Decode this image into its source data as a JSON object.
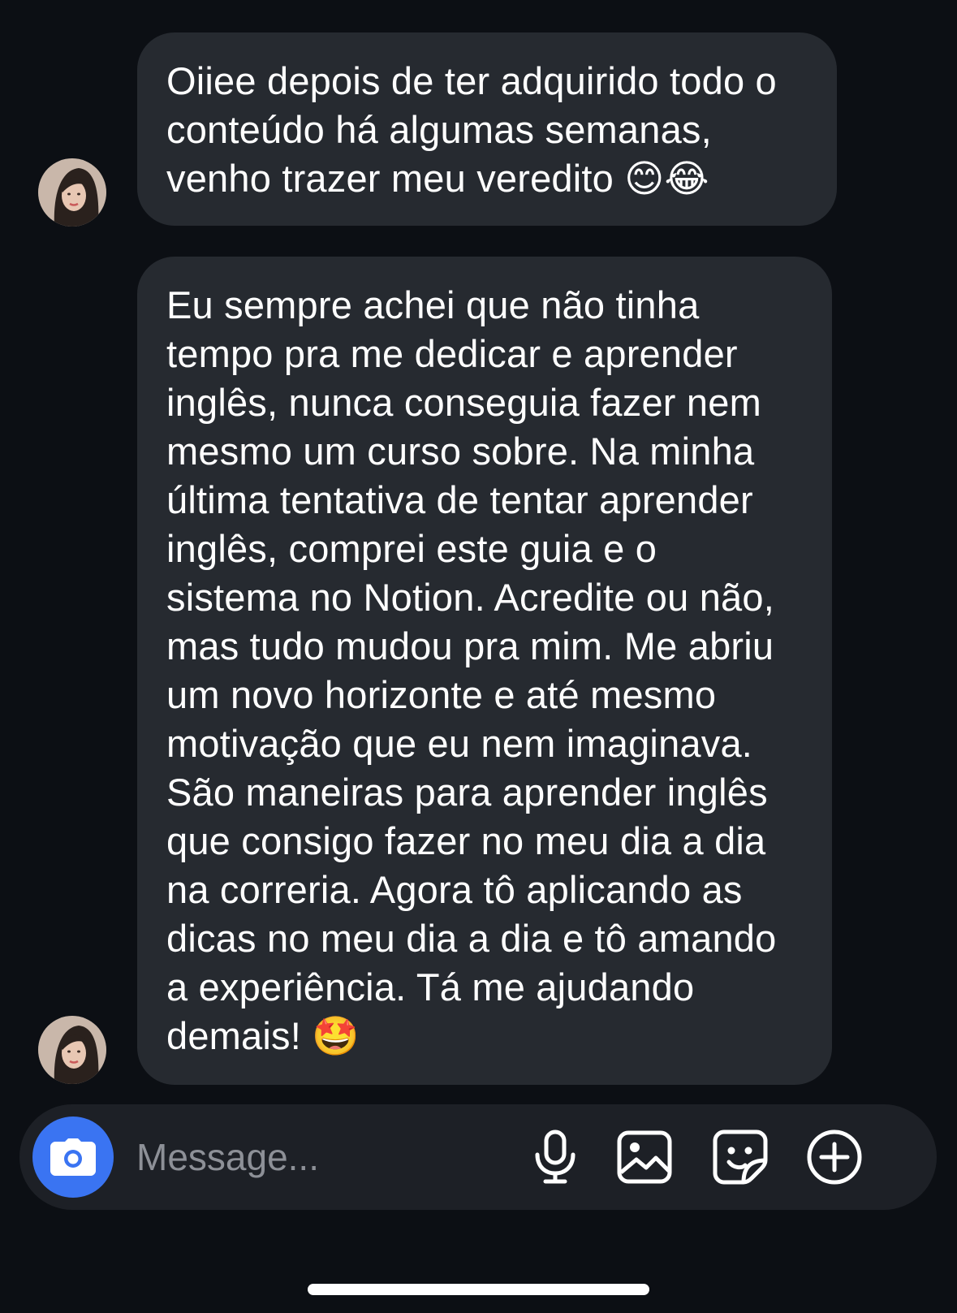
{
  "messages": [
    {
      "sender": "other",
      "lines": [
        "Oiiee depois de ter adquirido todo o",
        "conteúdo há algumas semanas,",
        "venho trazer meu veredito 😊😂"
      ]
    },
    {
      "sender": "other",
      "lines": [
        "Eu sempre achei que não tinha",
        "tempo pra me dedicar e aprender",
        "inglês, nunca conseguia fazer nem",
        "mesmo um curso sobre. Na minha",
        "última tentativa de tentar aprender",
        "inglês, comprei este guia e o",
        "sistema no Notion. Acredite ou não,",
        "mas tudo mudou pra mim. Me abriu",
        "um novo horizonte e até mesmo",
        "motivação que eu nem imaginava.",
        "São maneiras para aprender inglês",
        "que consigo fazer no meu dia a dia",
        "na correria. Agora tô aplicando as",
        "dicas no meu dia a dia e tô amando",
        "a experiência. Tá me ajudando",
        "demais! 🤩"
      ]
    }
  ],
  "composer": {
    "placeholder": "Message...",
    "camera_icon": "camera-icon",
    "tools": [
      "microphone-icon",
      "image-icon",
      "sticker-icon",
      "plus-circle-icon"
    ]
  },
  "colors": {
    "background": "#0c0f14",
    "bubble": "#262a30",
    "composer": "#1d2026",
    "accent": "#3a74f2",
    "placeholder": "#8d9097"
  }
}
